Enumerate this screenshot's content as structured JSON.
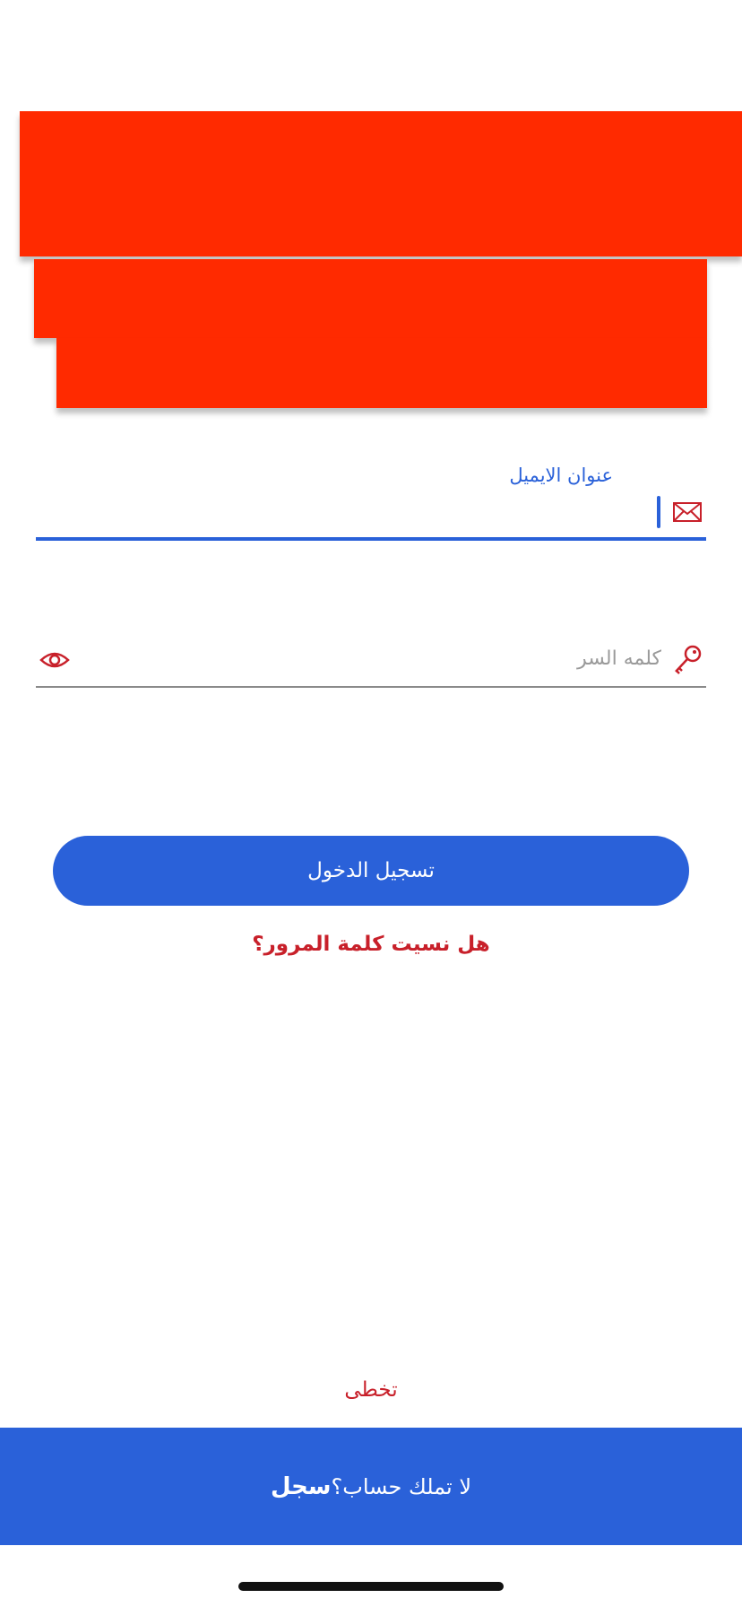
{
  "colors": {
    "redaction": "#ff2a00",
    "primary": "#2a61d9",
    "accent_red": "#c8202a",
    "placeholder_gray": "#9a9a9a"
  },
  "email_field": {
    "label": "عنوان الايميل",
    "value": "",
    "icon": "envelope-icon"
  },
  "password_field": {
    "placeholder": "كلمه السر",
    "value": "",
    "icon": "key-icon",
    "toggle_icon": "eye-icon"
  },
  "login_button": {
    "label": "تسجيل الدخول"
  },
  "forgot_password": {
    "label": "هل نسيت كلمة المرور؟"
  },
  "skip": {
    "label": "تخطى"
  },
  "register_bar": {
    "prompt": "لا تملك حساب؟",
    "action": "سجل"
  }
}
